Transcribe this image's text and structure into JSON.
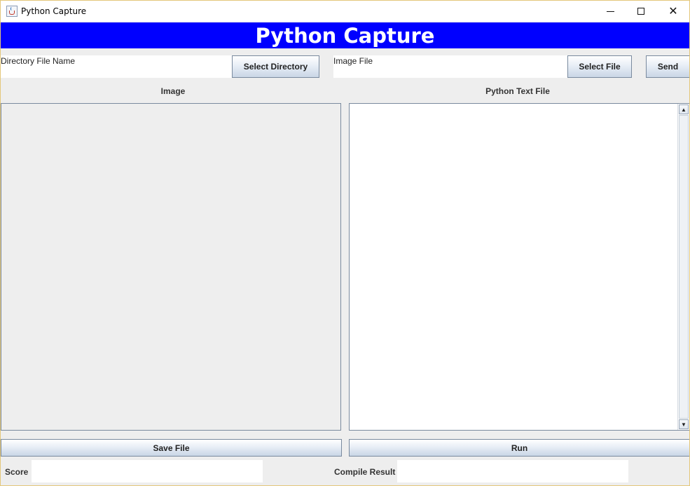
{
  "window": {
    "title": "Python Capture",
    "icon": "java-cup-icon",
    "controls": {
      "minimize": "minimize-icon",
      "maximize": "maximize-icon",
      "close": "close-icon",
      "close_glyph": "✕"
    }
  },
  "banner": {
    "title": "Python Capture",
    "background": "#0000ff",
    "color": "#ffffff"
  },
  "top_row": {
    "directory_field": {
      "value": "Directory File Name"
    },
    "select_directory_label": "Select Directory",
    "image_field": {
      "value": "Image File"
    },
    "select_file_label": "Select File",
    "send_label": "Send"
  },
  "panels": {
    "image_label": "Image",
    "python_label": "Python Text File",
    "python_text": "",
    "scroll_up_glyph": "▲",
    "scroll_down_glyph": "▼"
  },
  "actions": {
    "save_label": "Save File",
    "run_label": "Run"
  },
  "bottom_row": {
    "score_label": "Score",
    "score_value": "",
    "compile_label": "Compile Result",
    "compile_value": ""
  }
}
